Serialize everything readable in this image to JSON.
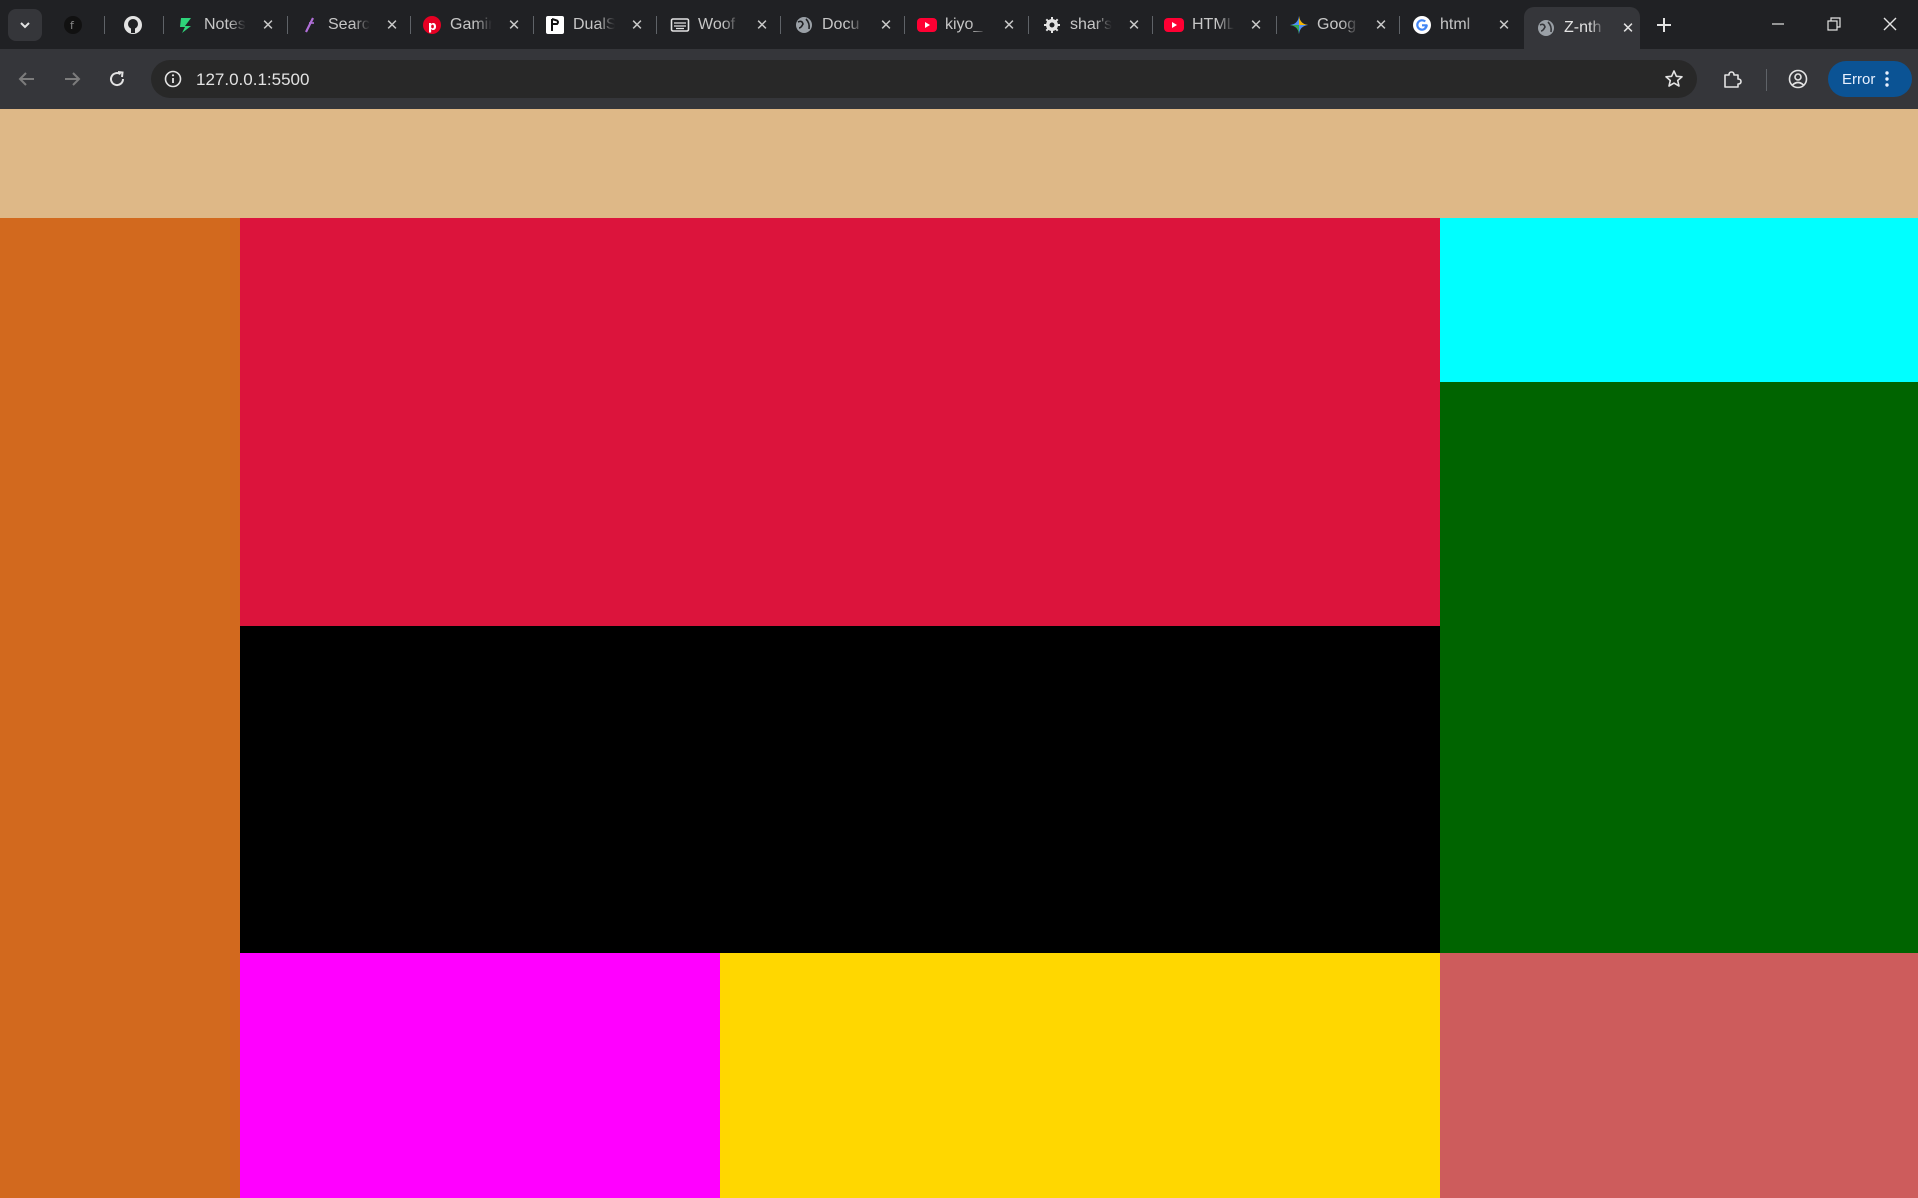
{
  "browser": {
    "tabs": [
      {
        "title": "",
        "icon": "circle-f-icon"
      },
      {
        "title": "",
        "icon": "github-icon"
      },
      {
        "title": "Notes",
        "icon": "notes-app-icon"
      },
      {
        "title": "Search",
        "icon": "slash-search-icon"
      },
      {
        "title": "Gaming",
        "icon": "pinterest-icon"
      },
      {
        "title": "DualSense",
        "icon": "playstation-icon"
      },
      {
        "title": "Woof",
        "icon": "keyboard-icon"
      },
      {
        "title": "Docu",
        "icon": "globe-icon"
      },
      {
        "title": "kiyo_",
        "icon": "youtube-icon"
      },
      {
        "title": "shar's",
        "icon": "gear-icon"
      },
      {
        "title": "HTML",
        "icon": "youtube-icon"
      },
      {
        "title": "Goog",
        "icon": "gemini-icon"
      },
      {
        "title": "html",
        "icon": "google-icon"
      },
      {
        "title": "Z-nth",
        "icon": "globe-icon",
        "active": true
      }
    ],
    "address": "127.0.0.1:5500",
    "error_label": "Error"
  },
  "page": {
    "colors": {
      "header": "#DEB887",
      "left_sidebar": "#D2691E",
      "main_top": "#DC143C",
      "main_middle": "#000000",
      "right_top": "#00FFFF",
      "right_middle": "#006400",
      "bottom_left": "#FF00FF",
      "bottom_middle": "#FFD700",
      "bottom_right": "#CD5C5C"
    }
  }
}
